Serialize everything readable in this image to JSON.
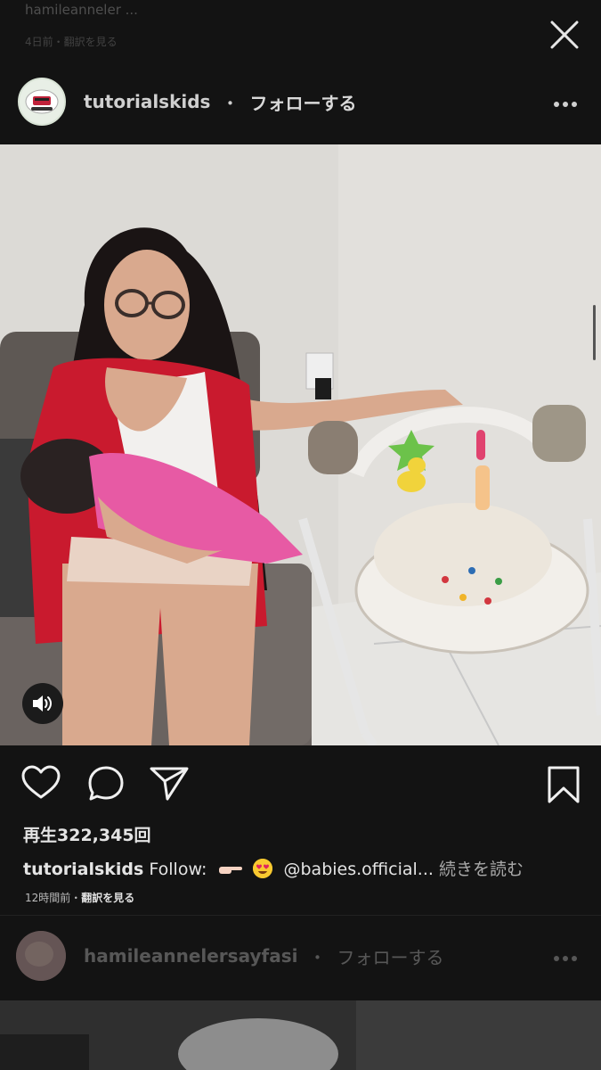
{
  "previous_post": {
    "caption_line": "hamileanneler ... ",
    "meta_line": "4日前・翻訳を見る"
  },
  "header": {
    "username": "tutorialskids",
    "separator": "・",
    "follow_label": "フォローする",
    "more_icon": "more-horizontal-icon",
    "close_icon": "close-icon"
  },
  "media": {
    "type": "video",
    "mute_icon": "speaker-icon"
  },
  "actions": {
    "like_icon": "heart-icon",
    "comment_icon": "comment-icon",
    "share_icon": "paper-plane-icon",
    "save_icon": "bookmark-icon"
  },
  "post": {
    "views": "再生322,345回",
    "caption_user": "tutorialskids",
    "caption_text": "Follow:",
    "caption_mention": "@babies.official...",
    "read_more": "続きを読む",
    "time": "12時間前・",
    "translate": "翻訳を見る"
  },
  "next_post": {
    "username": "hamileannelersayfasi",
    "separator": "・",
    "follow_label": "フォローする"
  },
  "colors": {
    "background": "#131313",
    "text": "#e4e4e4",
    "muted": "#a8a8a8"
  }
}
